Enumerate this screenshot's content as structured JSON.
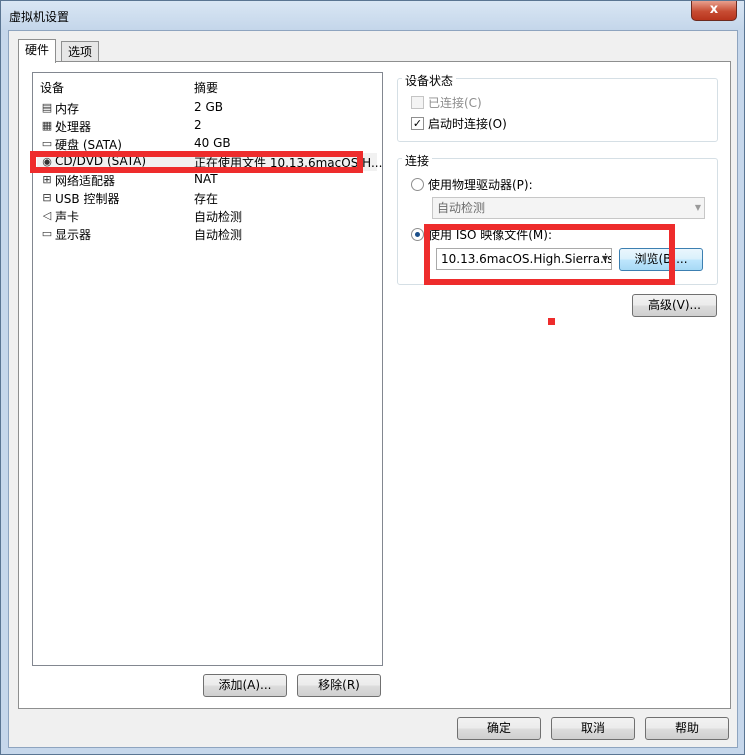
{
  "window": {
    "title": "虚拟机设置",
    "close_glyph": "x"
  },
  "tabs": [
    {
      "label": "硬件"
    },
    {
      "label": "选项"
    }
  ],
  "device_list": {
    "headers": {
      "device": "设备",
      "summary": "摘要"
    },
    "rows": [
      {
        "name": "内存",
        "summary": "2 GB",
        "icon": "memory-icon"
      },
      {
        "name": "处理器",
        "summary": "2",
        "icon": "processor-icon"
      },
      {
        "name": "硬盘 (SATA)",
        "summary": "40 GB",
        "icon": "hard-disk-icon"
      },
      {
        "name": "CD/DVD (SATA)",
        "summary": "正在使用文件 10.13.6macOS.H...",
        "icon": "cd-dvd-icon",
        "selected": true
      },
      {
        "name": "网络适配器",
        "summary": "NAT",
        "icon": "network-adapter-icon"
      },
      {
        "name": "USB 控制器",
        "summary": "存在",
        "icon": "usb-icon"
      },
      {
        "name": "声卡",
        "summary": "自动检测",
        "icon": "sound-card-icon"
      },
      {
        "name": "显示器",
        "summary": "自动检测",
        "icon": "display-icon"
      }
    ]
  },
  "list_buttons": {
    "add": "添加(A)...",
    "remove": "移除(R)"
  },
  "device_status": {
    "title": "设备状态",
    "connected": {
      "label": "已连接(C)",
      "checked": false,
      "enabled": false
    },
    "connect_at_power_on": {
      "label": "启动时连接(O)",
      "checked": true
    }
  },
  "connection": {
    "title": "连接",
    "physical_drive": {
      "label": "使用物理驱动器(P):",
      "selected": false
    },
    "physical_drive_value": "自动检测",
    "iso_image": {
      "label": "使用 ISO 映像文件(M):",
      "selected": true
    },
    "iso_value": "10.13.6macOS.High.Sierra.is",
    "browse": "浏览(B)..."
  },
  "advanced_button": "高级(V)...",
  "footer": {
    "ok": "确定",
    "cancel": "取消",
    "help": "帮助"
  },
  "colors": {
    "annotation": "#ee2c2c",
    "titlebar": "#c6d7eb",
    "close": "#c74c33"
  }
}
